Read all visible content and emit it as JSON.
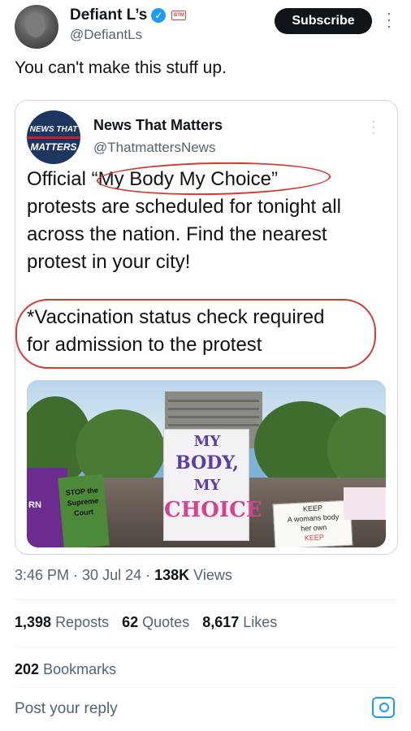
{
  "author": {
    "display_name": "Defiant L’s",
    "handle": "@DefiantLs",
    "badge_text": "BTM",
    "subscribe_label": "Subscribe"
  },
  "tweet": {
    "text": "You can't make this stuff up."
  },
  "quoted": {
    "avatar_line1": "NEWS THAT",
    "avatar_line2": "MATTERS",
    "display_name": "News That Matters",
    "handle": "@ThatmattersNews",
    "body_lines": [
      "Official “My Body My Choice”",
      "protests are scheduled for tonight all",
      "across the nation. Find the nearest",
      "protest in your city!"
    ],
    "note_lines": [
      "*Vaccination status check required",
      "for admission to the protest"
    ],
    "photo_signs": {
      "main": [
        "MY",
        "BODY,",
        "MY",
        "CHOICE"
      ],
      "green": [
        "STOP the",
        "Supreme",
        "Court"
      ],
      "white": [
        "KEEP",
        "A womans body",
        "her own",
        "KEEP"
      ],
      "left_edge": "RN"
    }
  },
  "meta": {
    "time": "3:46 PM",
    "date": "30 Jul 24",
    "views_count": "138K",
    "views_label": "Views"
  },
  "stats": {
    "reposts_count": "1,398",
    "reposts_label": "Reposts",
    "quotes_count": "62",
    "quotes_label": "Quotes",
    "likes_count": "8,617",
    "likes_label": "Likes",
    "bookmarks_count": "202",
    "bookmarks_label": "Bookmarks"
  },
  "reply": {
    "placeholder": "Post your reply"
  },
  "icons": {
    "verified": "verified-badge-icon",
    "more": "more-options-icon",
    "camera": "camera-icon"
  },
  "colors": {
    "accent": "#1d9bf0",
    "annotation": "#d33a2f"
  }
}
